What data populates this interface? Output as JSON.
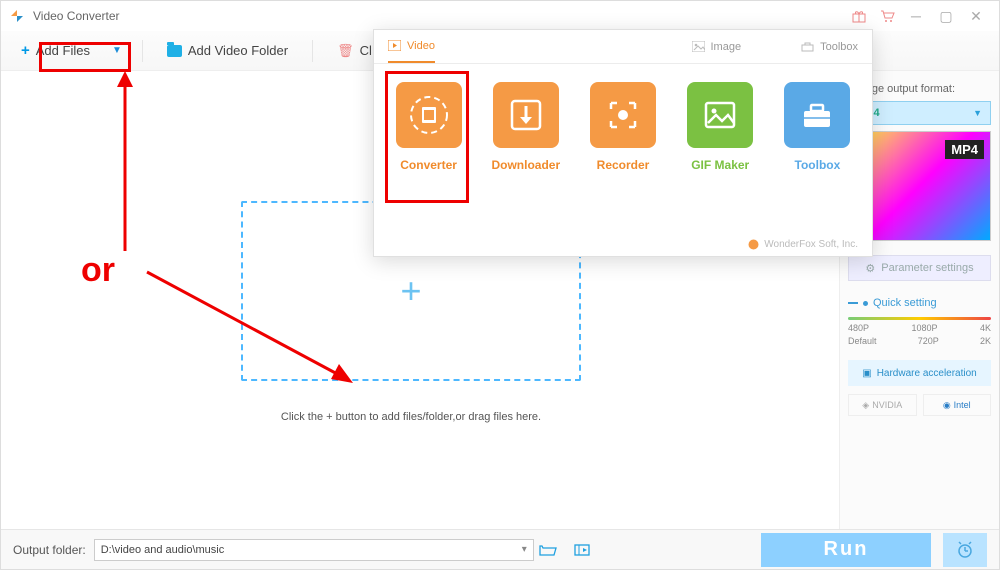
{
  "titlebar": {
    "title": "Video Converter"
  },
  "toolbar": {
    "add_files": "Add Files",
    "add_folder": "Add Video Folder",
    "clear": "Cl"
  },
  "dropzone": {
    "hint": "Click the + button to add files/folder,or drag files here."
  },
  "sidebar": {
    "change_label": "change output format:",
    "format": "MP4",
    "thumb_tag": "MP4",
    "param_btn": "Parameter settings",
    "quick_setting": "Quick setting",
    "resolutions_top": [
      "480P",
      "1080P",
      "4K"
    ],
    "resolutions_bot": [
      "Default",
      "720P",
      "2K"
    ],
    "hw_label": "Hardware acceleration",
    "vendor1": "NVIDIA",
    "vendor2": "Intel"
  },
  "footer": {
    "label": "Output folder:",
    "path": "D:\\video and audio\\music",
    "run": "Run"
  },
  "popup": {
    "tabs": {
      "video": "Video",
      "image": "Image",
      "toolbox": "Toolbox"
    },
    "tiles": {
      "converter": "Converter",
      "downloader": "Downloader",
      "recorder": "Recorder",
      "gif": "GIF Maker",
      "toolbox": "Toolbox"
    },
    "footer": "WonderFox Soft, Inc."
  },
  "annotation": {
    "or": "or"
  }
}
